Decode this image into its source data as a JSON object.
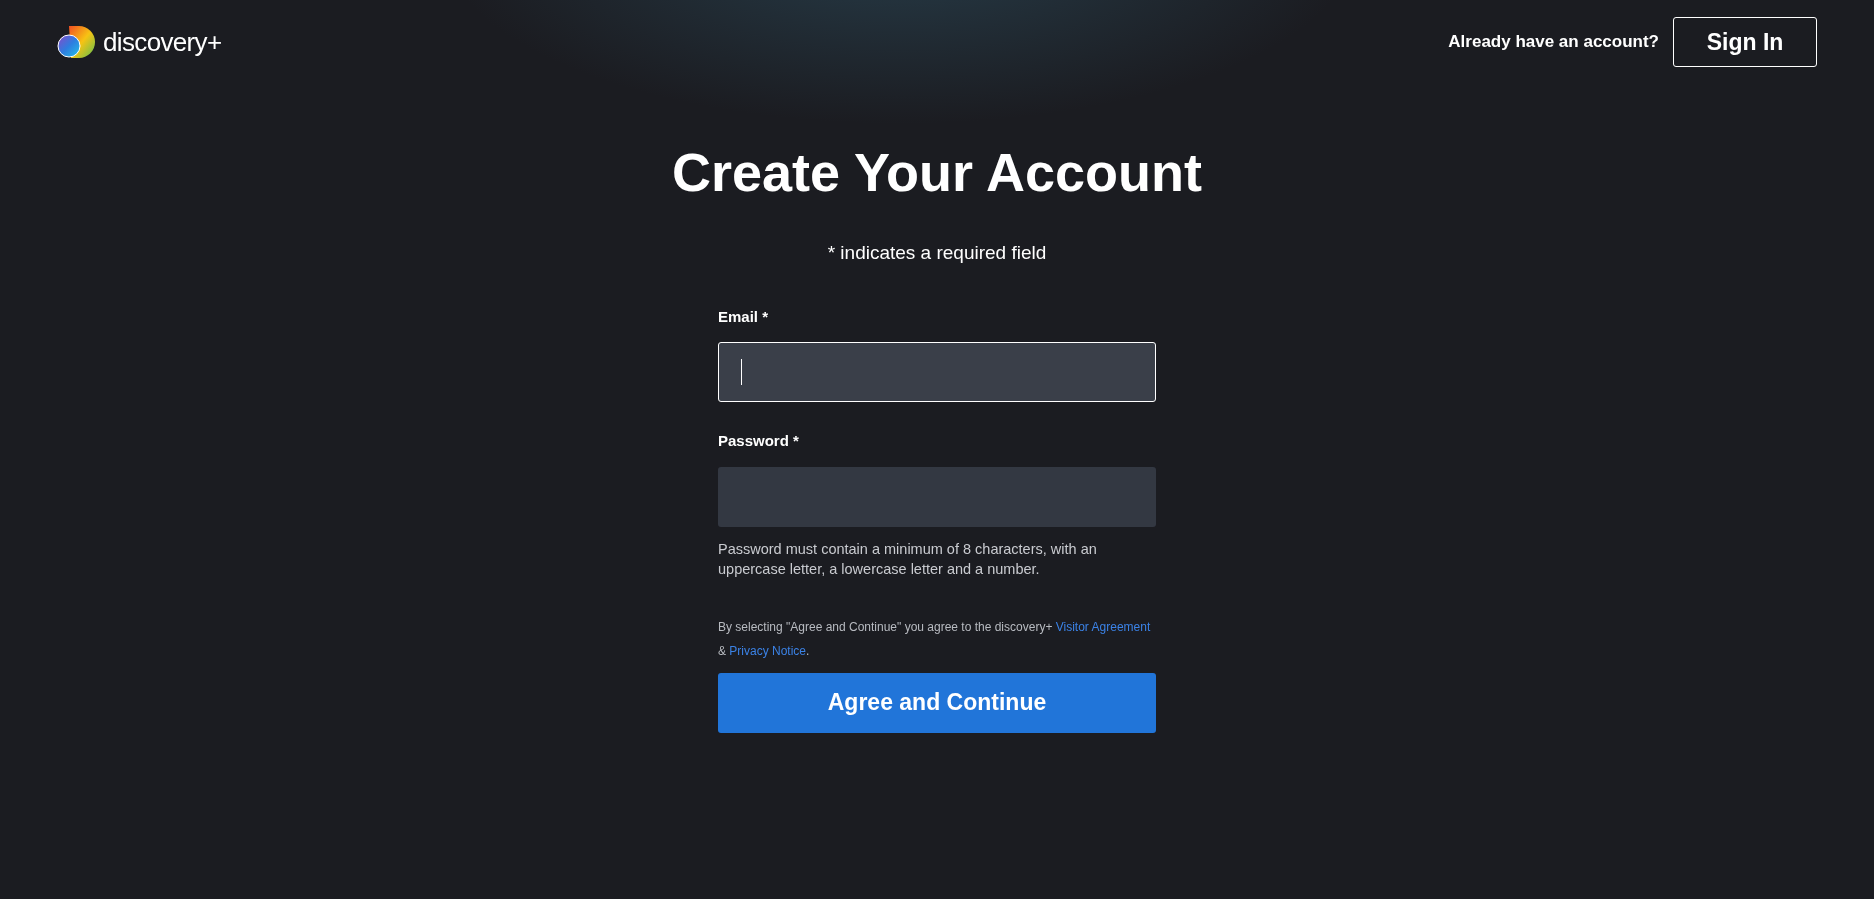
{
  "header": {
    "brand": "discovery+",
    "prompt": "Already have an account?",
    "sign_in": "Sign In"
  },
  "title": "Create Your Account",
  "required_note": "* indicates a required field",
  "fields": [
    {
      "label": "Email *",
      "focused": true
    },
    {
      "label": "Password *",
      "focused": false,
      "hint": "Password must contain a minimum of 8 characters, with an uppercase letter, a lowercase letter and a number."
    }
  ],
  "legal": [
    {
      "kind": "text",
      "text": "By selecting \"Agree and Continue\" you agree to the discovery+ "
    },
    {
      "kind": "link",
      "text": "Visitor Agreement"
    },
    {
      "kind": "text",
      "text": " & "
    },
    {
      "kind": "link",
      "text": "Privacy Notice"
    },
    {
      "kind": "text",
      "text": "."
    }
  ],
  "submit": "Agree and Continue"
}
